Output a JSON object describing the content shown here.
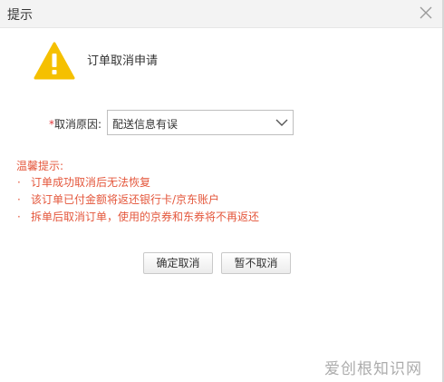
{
  "dialog": {
    "title": "提示",
    "heading": "订单取消申请",
    "close_icon": "close-icon",
    "warning_icon": "warning-icon",
    "warning_color": "#f5c000"
  },
  "reason": {
    "required_mark": "*",
    "label": "取消原因:",
    "selected": "配送信息有误",
    "chevron_icon": "chevron-down-icon"
  },
  "tips": {
    "title": "温馨提示:",
    "color": "#e4573c",
    "bullet": "·",
    "items": [
      "订单成功取消后无法恢复",
      "该订单已付金额将返还银行卡/京东账户",
      "拆单后取消订单，使用的京券和东券将不再返还"
    ]
  },
  "actions": {
    "confirm_label": "确定取消",
    "cancel_label": "暂不取消"
  },
  "watermark": {
    "text": "爱创根知识网"
  }
}
